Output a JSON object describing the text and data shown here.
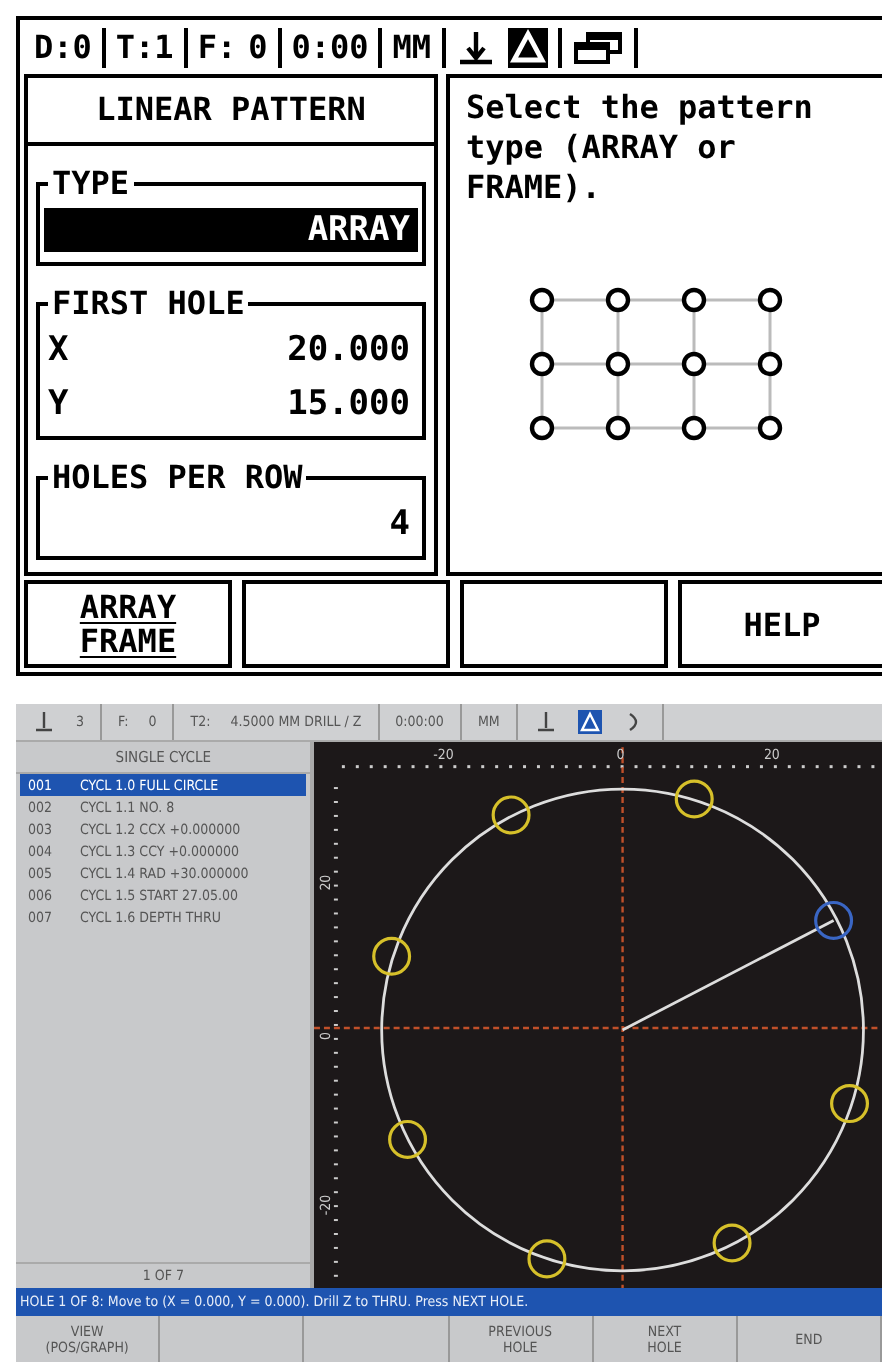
{
  "dro": {
    "status_bar": [
      {
        "parts": [
          {
            "kind": "text",
            "text": "D:0"
          }
        ]
      },
      {
        "parts": [
          {
            "kind": "text",
            "text": "T:1"
          }
        ]
      },
      {
        "parts": [
          {
            "kind": "text",
            "text": "F:"
          },
          {
            "kind": "text",
            "text": "0"
          }
        ]
      },
      {
        "parts": [
          {
            "kind": "text",
            "text": "0:00"
          }
        ]
      },
      {
        "parts": [
          {
            "kind": "text",
            "text": "MM"
          }
        ]
      },
      {
        "parts": [
          {
            "kind": "axis",
            "on": false
          },
          {
            "kind": "delta",
            "on": true
          }
        ]
      },
      {
        "parts": [
          {
            "kind": "windows",
            "on": false
          }
        ]
      }
    ],
    "form": {
      "title": "LINEAR PATTERN",
      "groups": [
        {
          "label": "TYPE",
          "rows": [
            {
              "value": "ARRAY",
              "selected": true
            }
          ]
        },
        {
          "label": "FIRST HOLE",
          "rows": [
            {
              "label": "X",
              "value": "20.000",
              "selected": false
            },
            {
              "label": "Y",
              "value": "15.000",
              "selected": false
            }
          ]
        },
        {
          "label": "HOLES PER ROW",
          "rows": [
            {
              "value": "4",
              "selected": false
            }
          ]
        }
      ]
    },
    "help_text": "Select the pattern type (ARRAY or FRAME).",
    "softkeys": [
      {
        "kind": "toggle",
        "lines": [
          "ARRAY",
          "FRAME"
        ]
      },
      {
        "kind": "blank"
      },
      {
        "kind": "blank"
      },
      {
        "kind": "label",
        "lines": [
          "HELP"
        ]
      }
    ]
  },
  "cnc": {
    "status_bar": [
      {
        "parts": [
          {
            "kind": "axis",
            "on": false
          },
          {
            "kind": "text",
            "text": "3"
          }
        ]
      },
      {
        "parts": [
          {
            "kind": "text",
            "text": "F:"
          },
          {
            "kind": "text",
            "text": "0"
          }
        ]
      },
      {
        "parts": [
          {
            "kind": "text",
            "text": "T2:"
          },
          {
            "kind": "text",
            "text": "4.5000 MM DRILL / Z"
          }
        ]
      },
      {
        "parts": [
          {
            "kind": "text",
            "text": "0:00:00"
          }
        ]
      },
      {
        "parts": [
          {
            "kind": "text",
            "text": "MM"
          }
        ]
      },
      {
        "parts": [
          {
            "kind": "axis",
            "on": false
          },
          {
            "kind": "delta",
            "on": true
          },
          {
            "kind": "arc",
            "on": false
          }
        ]
      }
    ],
    "program": {
      "title": "SINGLE CYCLE",
      "rows": [
        {
          "number": "001",
          "text": "CYCL 1.0 FULL CIRCLE",
          "selected": true
        },
        {
          "number": "002",
          "text": "CYCL 1.1 NO. 8",
          "selected": false
        },
        {
          "number": "003",
          "text": "CYCL 1.2 CCX +0.000000",
          "selected": false
        },
        {
          "number": "004",
          "text": "CYCL 1.3 CCY +0.000000",
          "selected": false
        },
        {
          "number": "005",
          "text": "CYCL 1.4 RAD +30.000000",
          "selected": false
        },
        {
          "number": "006",
          "text": "CYCL 1.5 START 27.05.00",
          "selected": false
        },
        {
          "number": "007",
          "text": "CYCL 1.6 DEPTH THRU",
          "selected": false
        }
      ],
      "footer": "1 OF 7"
    },
    "graph": {
      "x_labels": [
        "-20",
        "0",
        "20"
      ],
      "y_labels": [
        "20",
        "0",
        "-20"
      ]
    },
    "message": "HOLE 1 OF 8: Move to (X = 0.000, Y = 0.000). Drill Z to THRU. Press NEXT HOLE.",
    "softkeys": [
      {
        "kind": "label",
        "lines": [
          "VIEW",
          "(POS/GRAPH)"
        ]
      },
      {
        "kind": "blank"
      },
      {
        "kind": "blank"
      },
      {
        "kind": "label",
        "lines": [
          "PREVIOUS",
          "HOLE"
        ]
      },
      {
        "kind": "label",
        "lines": [
          "NEXT",
          "HOLE"
        ]
      },
      {
        "kind": "label",
        "lines": [
          "END"
        ]
      }
    ]
  }
}
